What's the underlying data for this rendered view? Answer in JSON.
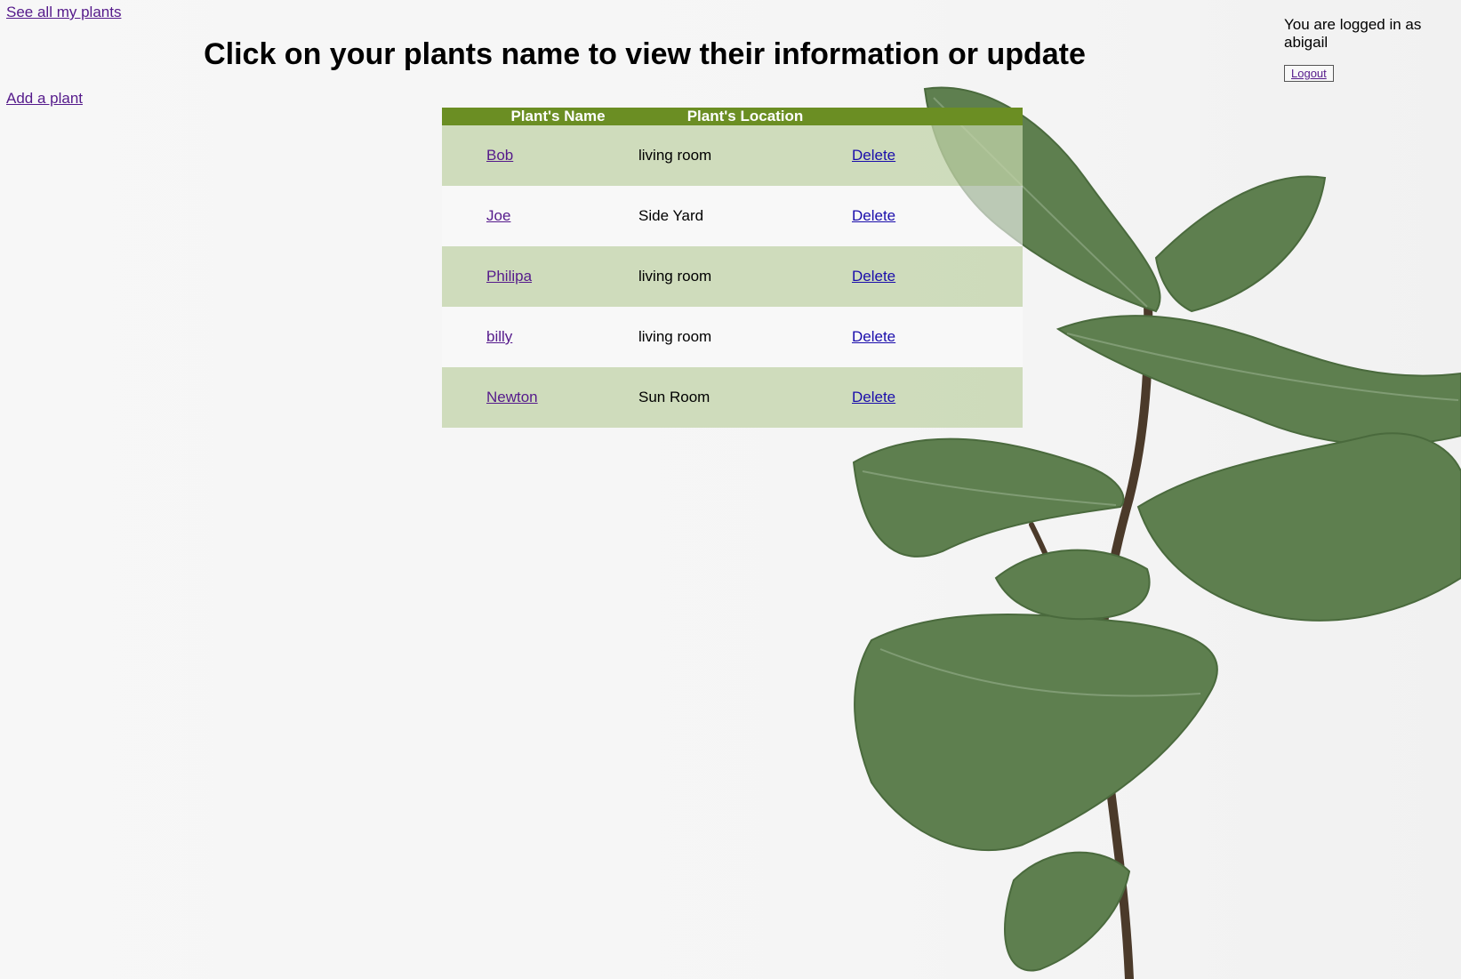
{
  "nav": {
    "see_all_label": "See all my plants",
    "add_plant_label": "Add a plant"
  },
  "page_title": "Click on your plants name to view their information or update",
  "session": {
    "logged_in_text": "You are logged in as abigail",
    "logout_label": "Logout"
  },
  "table": {
    "headers": [
      "Plant's Name",
      "Plant's Location",
      ""
    ],
    "rows": [
      {
        "name": "Bob",
        "location": "living room",
        "action": "Delete"
      },
      {
        "name": "Joe",
        "location": "Side Yard",
        "action": "Delete"
      },
      {
        "name": "Philipa",
        "location": "living room",
        "action": "Delete"
      },
      {
        "name": "billy",
        "location": "living room",
        "action": "Delete"
      },
      {
        "name": "Newton",
        "location": "Sun Room",
        "action": "Delete"
      }
    ]
  },
  "colors": {
    "header_bg": "#6b8e23",
    "row_alt_bg": "#c2d3a8",
    "visited_link": "#551a8b",
    "link": "#1a0dab"
  },
  "background_image": "fiddle-leaf-fig-plant"
}
